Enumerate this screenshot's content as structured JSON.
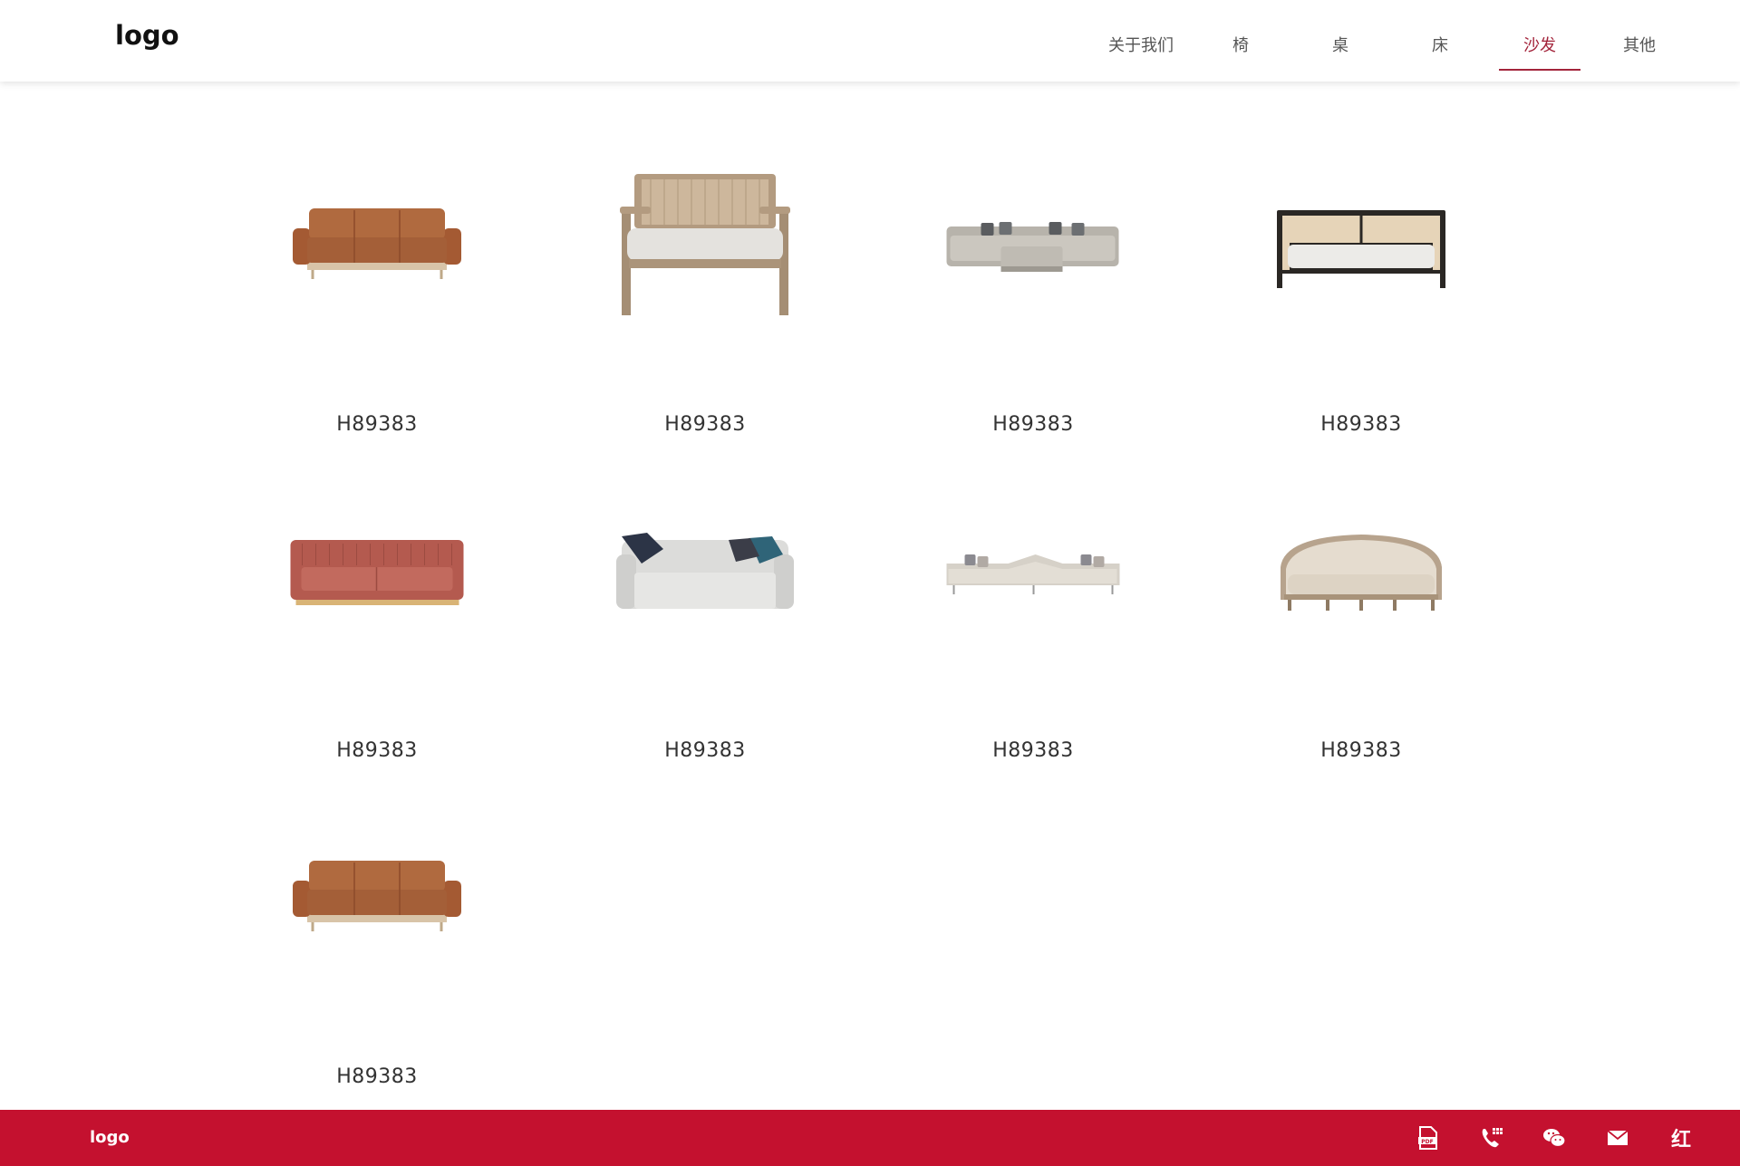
{
  "header": {
    "logo": "logo",
    "nav": [
      {
        "label": "关于我们",
        "active": false
      },
      {
        "label": "椅",
        "active": false
      },
      {
        "label": "桌",
        "active": false
      },
      {
        "label": "床",
        "active": false
      },
      {
        "label": "沙发",
        "active": true
      },
      {
        "label": "其他",
        "active": false
      }
    ]
  },
  "products": [
    {
      "code": "H89383",
      "image": "leather-sofa-image"
    },
    {
      "code": "H89383",
      "image": "cane-bench-image"
    },
    {
      "code": "H89383",
      "image": "sectional-sofa-image"
    },
    {
      "code": "H89383",
      "image": "cane-daybed-image"
    },
    {
      "code": "H89383",
      "image": "pink-velvet-sofa-image"
    },
    {
      "code": "H89383",
      "image": "white-slipcover-sofa-image"
    },
    {
      "code": "H89383",
      "image": "corner-sectional-image"
    },
    {
      "code": "H89383",
      "image": "camelback-sofa-image"
    },
    {
      "code": "H89383",
      "image": "leather-sofa-image"
    }
  ],
  "footer": {
    "logo": "logo",
    "icons": [
      "pdf-icon",
      "phone-icon",
      "wechat-icon",
      "mail-icon",
      "brand-icon"
    ]
  },
  "colors": {
    "accent": "#a3243b",
    "footer_bg": "#c4112f"
  }
}
